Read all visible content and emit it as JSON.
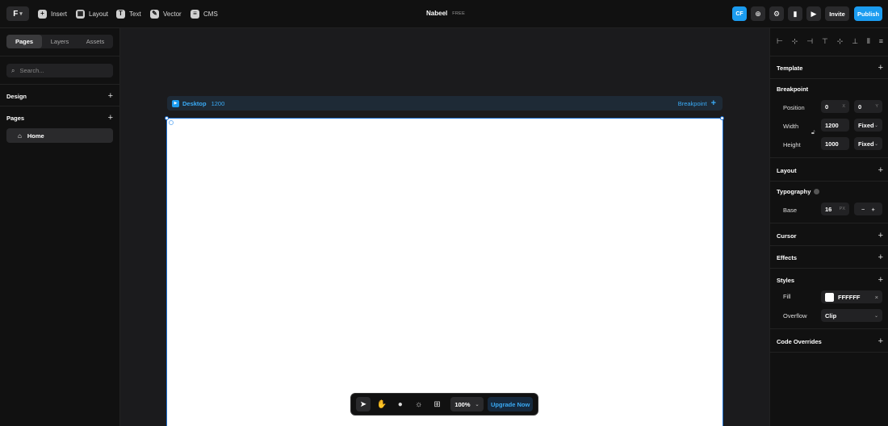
{
  "topbar": {
    "logo": "F",
    "tools": [
      {
        "label": "Insert",
        "icon": "plus-square-icon"
      },
      {
        "label": "Layout",
        "icon": "layout-icon"
      },
      {
        "label": "Text",
        "icon": "text-icon"
      },
      {
        "label": "Vector",
        "icon": "pen-icon"
      },
      {
        "label": "CMS",
        "icon": "database-icon"
      }
    ],
    "project_name": "Nabeel",
    "plan": "FREE",
    "avatar": "CF",
    "invite_label": "Invite",
    "publish_label": "Publish",
    "accent_color": "#1b9cf0"
  },
  "left_panel": {
    "tabs": [
      "Pages",
      "Layers",
      "Assets"
    ],
    "active_tab": "Pages",
    "search_placeholder": "Search...",
    "design_label": "Design",
    "pages_label": "Pages",
    "pages": [
      {
        "label": "Home",
        "icon": "home-icon"
      }
    ]
  },
  "canvas": {
    "frame_name": "Desktop",
    "frame_width": "1200",
    "breakpoint_label": "Breakpoint",
    "frame_fill": "#ffffff"
  },
  "bottom_toolbar": {
    "zoom": "100%",
    "upgrade_label": "Upgrade Now"
  },
  "right_panel": {
    "template_label": "Template",
    "breakpoint_label": "Breakpoint",
    "position_label": "Position",
    "position_x": "0",
    "position_x_unit": "X",
    "position_y": "0",
    "position_y_unit": "Y",
    "width_label": "Width",
    "width_value": "1200",
    "width_mode": "Fixed",
    "height_label": "Height",
    "height_value": "1000",
    "height_mode": "Fixed",
    "layout_label": "Layout",
    "typography_label": "Typography",
    "base_label": "Base",
    "base_value": "16",
    "base_unit": "PX",
    "cursor_label": "Cursor",
    "effects_label": "Effects",
    "styles_label": "Styles",
    "fill_label": "Fill",
    "fill_value": "FFFFFF",
    "overflow_label": "Overflow",
    "overflow_value": "Clip",
    "code_overrides_label": "Code Overrides"
  }
}
